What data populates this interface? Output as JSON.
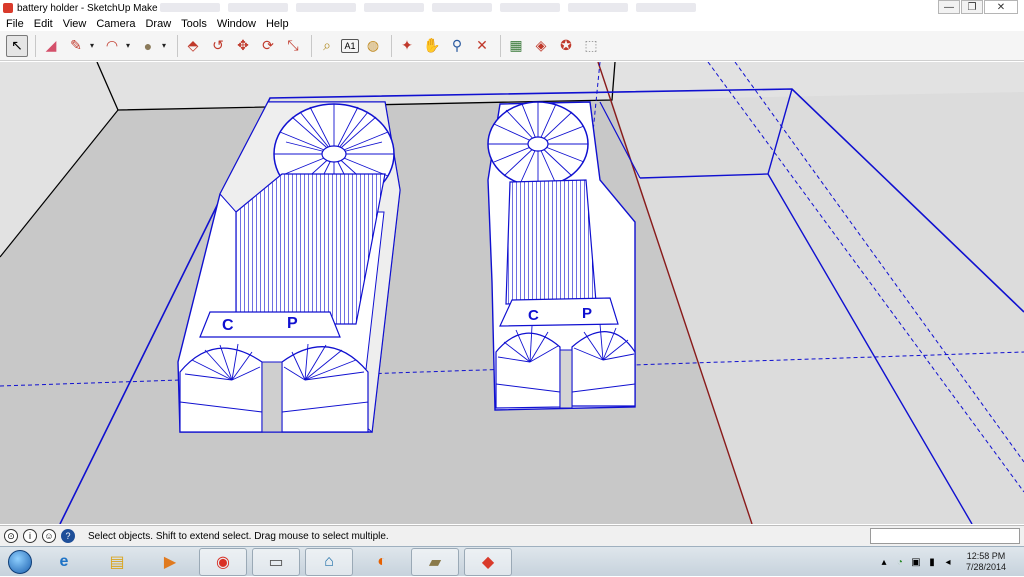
{
  "window": {
    "title": "battery holder - SketchUp Make"
  },
  "window_controls": {
    "minimize": "—",
    "maximize": "❐",
    "close": "✕"
  },
  "menu": [
    "File",
    "Edit",
    "View",
    "Camera",
    "Draw",
    "Tools",
    "Window",
    "Help"
  ],
  "toolbar": {
    "tools": [
      {
        "name": "select-tool-icon",
        "glyph": "↖",
        "active": true
      },
      {
        "name": "eraser-tool-icon",
        "glyph": "◢"
      },
      {
        "name": "pencil-line-tool-icon",
        "glyph": "✎",
        "dropdown": "▾"
      },
      {
        "name": "arc-tool-icon",
        "glyph": "◠",
        "dropdown": "▾"
      },
      {
        "name": "shapes-tool-icon",
        "glyph": "●",
        "dropdown": "▾"
      },
      {
        "name": "push-pull-tool-icon",
        "glyph": "⬘"
      },
      {
        "name": "follow-me-tool-icon",
        "glyph": "↺"
      },
      {
        "name": "move-tool-icon",
        "glyph": "✥"
      },
      {
        "name": "rotate-tool-icon",
        "glyph": "⟳"
      },
      {
        "name": "scale-tool-icon",
        "glyph": "⤡"
      },
      {
        "name": "tape-measure-tool-icon",
        "glyph": "⌕"
      },
      {
        "name": "text-tool-icon",
        "glyph": "A1"
      },
      {
        "name": "paint-bucket-tool-icon",
        "glyph": "◍"
      },
      {
        "name": "orbit-tool-icon",
        "glyph": "✦"
      },
      {
        "name": "pan-tool-icon",
        "glyph": "✋"
      },
      {
        "name": "zoom-tool-icon",
        "glyph": "⚲"
      },
      {
        "name": "zoom-extents-tool-icon",
        "glyph": "✕"
      },
      {
        "name": "warehouse-icon",
        "glyph": "▦"
      },
      {
        "name": "share-model-icon",
        "glyph": "◈"
      },
      {
        "name": "extension-warehouse-icon",
        "glyph": "✪"
      },
      {
        "name": "share-component-icon",
        "glyph": "⬚"
      }
    ]
  },
  "model": {
    "labels": [
      "C",
      "P"
    ]
  },
  "statusbar": {
    "icons": [
      {
        "name": "geo-location-icon",
        "glyph": "⊙"
      },
      {
        "name": "credits-icon",
        "glyph": "i"
      },
      {
        "name": "user-sign-in-icon",
        "glyph": "☺"
      },
      {
        "name": "help-icon",
        "glyph": "?"
      }
    ],
    "message": "Select objects. Shift to extend select. Drag mouse to select multiple."
  },
  "taskbar": {
    "apps": [
      {
        "name": "internet-explorer-icon",
        "glyph": "e",
        "color": "#1e73c6"
      },
      {
        "name": "file-explorer-icon",
        "glyph": "▤",
        "color": "#d9a520"
      },
      {
        "name": "media-player-icon",
        "glyph": "▶",
        "color": "#e07a1f"
      },
      {
        "name": "chrome-icon",
        "glyph": "◉",
        "color": "#d93025"
      },
      {
        "name": "monitor-app-icon",
        "glyph": "▭",
        "color": "#555555"
      },
      {
        "name": "hp-app-icon",
        "glyph": "⌂",
        "color": "#1f6fa8"
      },
      {
        "name": "firefox-icon",
        "glyph": "◐",
        "color": "#e66000"
      },
      {
        "name": "scanner-app-icon",
        "glyph": "▰",
        "color": "#8a7a4a"
      },
      {
        "name": "sketchup-task-icon",
        "glyph": "◆",
        "color": "#d93a2b"
      }
    ],
    "tray": [
      {
        "name": "show-hidden-icons",
        "glyph": "▴"
      },
      {
        "name": "sync-tray-icon",
        "glyph": "◔"
      },
      {
        "name": "device-tray-icon",
        "glyph": "▣"
      },
      {
        "name": "network-tray-icon",
        "glyph": "▮"
      },
      {
        "name": "volume-tray-icon",
        "glyph": "◂"
      }
    ],
    "time": "12:58 PM",
    "date": "7/28/2014"
  },
  "colors": {
    "edge_blue": "#1010d0",
    "face": "#ffffff",
    "ground": "#c8c8c8",
    "sky": "#e2e2e2"
  }
}
